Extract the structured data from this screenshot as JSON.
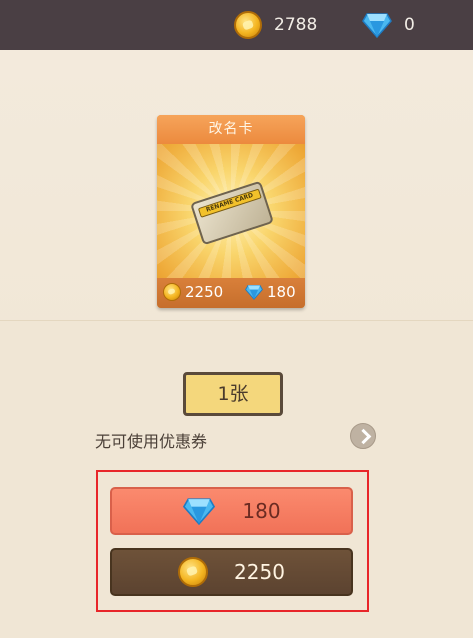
{
  "topbar": {
    "gold": "2788",
    "gems": "0"
  },
  "item": {
    "title": "改名卡",
    "card_text": "RENAME CARD",
    "price_gold": "2250",
    "price_gems": "180"
  },
  "quantity": "1张",
  "coupon_text": "无可使用优惠券",
  "buttons": {
    "gem_price": "180",
    "gold_price": "2250"
  },
  "icons": {
    "coin": "gold-coin-icon",
    "gem": "diamond-icon",
    "arrow": "chevron-right-icon"
  },
  "colors": {
    "gem_button": "#f17258",
    "gold_button": "#5c4330",
    "highlight": "#e8262a"
  }
}
